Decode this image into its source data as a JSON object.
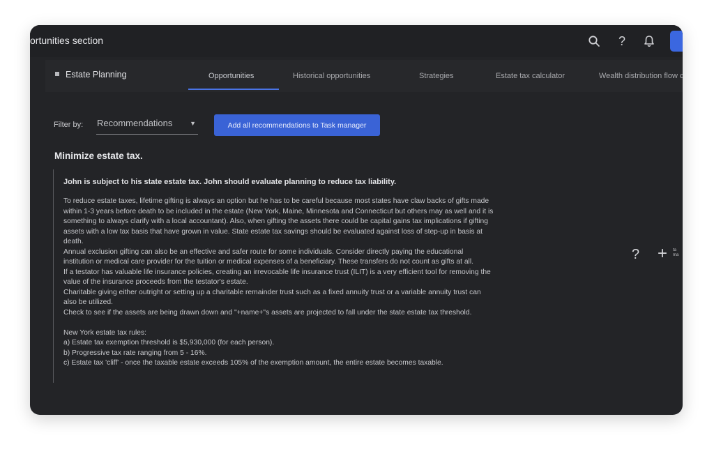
{
  "header": {
    "title": "ortunities section"
  },
  "section": {
    "name": "Estate Planning"
  },
  "tabs": [
    {
      "label": "Opportunities"
    },
    {
      "label": "Historical opportunities"
    },
    {
      "label": "Strategies"
    },
    {
      "label": "Estate tax calculator"
    },
    {
      "label": "Wealth distribution flow ch"
    }
  ],
  "filter": {
    "label": "Filter by:",
    "selected": "Recommendations",
    "add_button_label": "Add all recommendations to Task manager"
  },
  "content": {
    "heading": "Minimize estate tax.",
    "subheading": "John is subject to his state estate tax. John should evaluate planning to reduce tax liability.",
    "lines": [
      "To reduce estate taxes, lifetime gifting is always an option but he has to be careful because most states have claw backs of gifts made",
      "within 1-3 years before death to be included in the estate (New York, Maine, Minnesota and Connecticut but others may as well and it is",
      "something to always clarify with a local accountant). Also, when gifting the assets there could be capital gains tax implications if gifting",
      "assets with a low tax basis that have grown in value. State estate tax savings should be evaluated against loss of step-up in basis at",
      "death.",
      "Annual exclusion gifting can also be an effective and safer route for some individuals. Consider directly paying the educational",
      "institution or medical care provider for the tuition or medical expenses of a beneficiary. These transfers do not count as gifts at all.",
      "If a testator has valuable life insurance policies, creating an irrevocable life insurance trust (ILIT) is a very efficient tool for removing the",
      "value of the insurance proceeds from the testator's estate.",
      "Charitable giving either outright or setting up a charitable remainder trust such as a fixed annuity trust or a variable annuity trust can",
      "also be utilized.",
      "Check to see if the assets are being drawn down and \"+name+\"s assets are projected to fall under the state estate tax threshold.",
      "",
      "New York estate tax rules:",
      "a) Estate tax exemption threshold is $5,930,000 (for each person).",
      "b) Progressive tax rate ranging from 5 - 16%.",
      "c) Estate tax 'cliff' - once the taxable estate exceeds 105% of the exemption amount, the entire estate becomes taxable."
    ],
    "add_task_label": "ta ma"
  },
  "icons": {
    "search": "search-icon",
    "help": "help-icon",
    "bell": "bell-icon",
    "caret": "caret-down-icon",
    "plus": "plus-icon"
  },
  "colors": {
    "background": "#232427",
    "accent": "#3a63d6"
  }
}
